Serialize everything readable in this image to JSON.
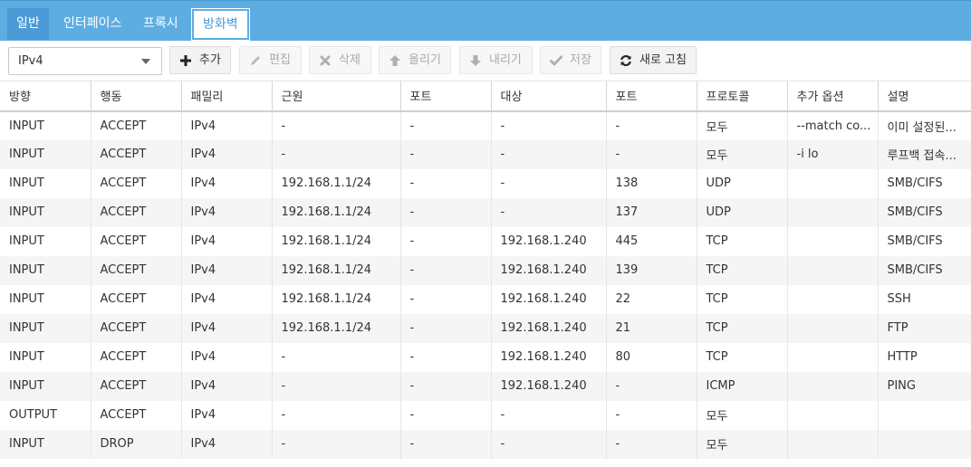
{
  "tabs": [
    {
      "label": "일반"
    },
    {
      "label": "인터페이스"
    },
    {
      "label": "프록시"
    },
    {
      "label": "방화벽"
    }
  ],
  "toolbar": {
    "family_select": "IPv4",
    "buttons": {
      "add": "추가",
      "edit": "편집",
      "delete": "삭제",
      "up": "올리기",
      "down": "내리기",
      "save": "저장",
      "refresh": "새로 고침"
    }
  },
  "colors": {
    "tab_bar": "#5dade2",
    "tab_first": "#4b9bd6",
    "row_alt": "#f5f5f5"
  },
  "table": {
    "headers": [
      "방향",
      "행동",
      "패밀리",
      "근원",
      "포트",
      "대상",
      "포트",
      "프로토콜",
      "추가 옵션",
      "설명"
    ],
    "rows": [
      [
        "INPUT",
        "ACCEPT",
        "IPv4",
        "-",
        "-",
        "-",
        "-",
        "모두",
        "--match co...",
        "이미 설정된..."
      ],
      [
        "INPUT",
        "ACCEPT",
        "IPv4",
        "-",
        "-",
        "-",
        "-",
        "모두",
        "-i lo",
        "루프백 접속..."
      ],
      [
        "INPUT",
        "ACCEPT",
        "IPv4",
        "192.168.1.1/24",
        "-",
        "-",
        "138",
        "UDP",
        "",
        "SMB/CIFS"
      ],
      [
        "INPUT",
        "ACCEPT",
        "IPv4",
        "192.168.1.1/24",
        "-",
        "-",
        "137",
        "UDP",
        "",
        "SMB/CIFS"
      ],
      [
        "INPUT",
        "ACCEPT",
        "IPv4",
        "192.168.1.1/24",
        "-",
        "192.168.1.240",
        "445",
        "TCP",
        "",
        "SMB/CIFS"
      ],
      [
        "INPUT",
        "ACCEPT",
        "IPv4",
        "192.168.1.1/24",
        "-",
        "192.168.1.240",
        "139",
        "TCP",
        "",
        "SMB/CIFS"
      ],
      [
        "INPUT",
        "ACCEPT",
        "IPv4",
        "192.168.1.1/24",
        "-",
        "192.168.1.240",
        "22",
        "TCP",
        "",
        "SSH"
      ],
      [
        "INPUT",
        "ACCEPT",
        "IPv4",
        "192.168.1.1/24",
        "-",
        "192.168.1.240",
        "21",
        "TCP",
        "",
        "FTP"
      ],
      [
        "INPUT",
        "ACCEPT",
        "IPv4",
        "-",
        "-",
        "192.168.1.240",
        "80",
        "TCP",
        "",
        "HTTP"
      ],
      [
        "INPUT",
        "ACCEPT",
        "IPv4",
        "-",
        "-",
        "192.168.1.240",
        "-",
        "ICMP",
        "",
        "PING"
      ],
      [
        "OUTPUT",
        "ACCEPT",
        "IPv4",
        "-",
        "-",
        "-",
        "-",
        "모두",
        "",
        ""
      ],
      [
        "INPUT",
        "DROP",
        "IPv4",
        "-",
        "-",
        "-",
        "-",
        "모두",
        "",
        ""
      ]
    ]
  }
}
